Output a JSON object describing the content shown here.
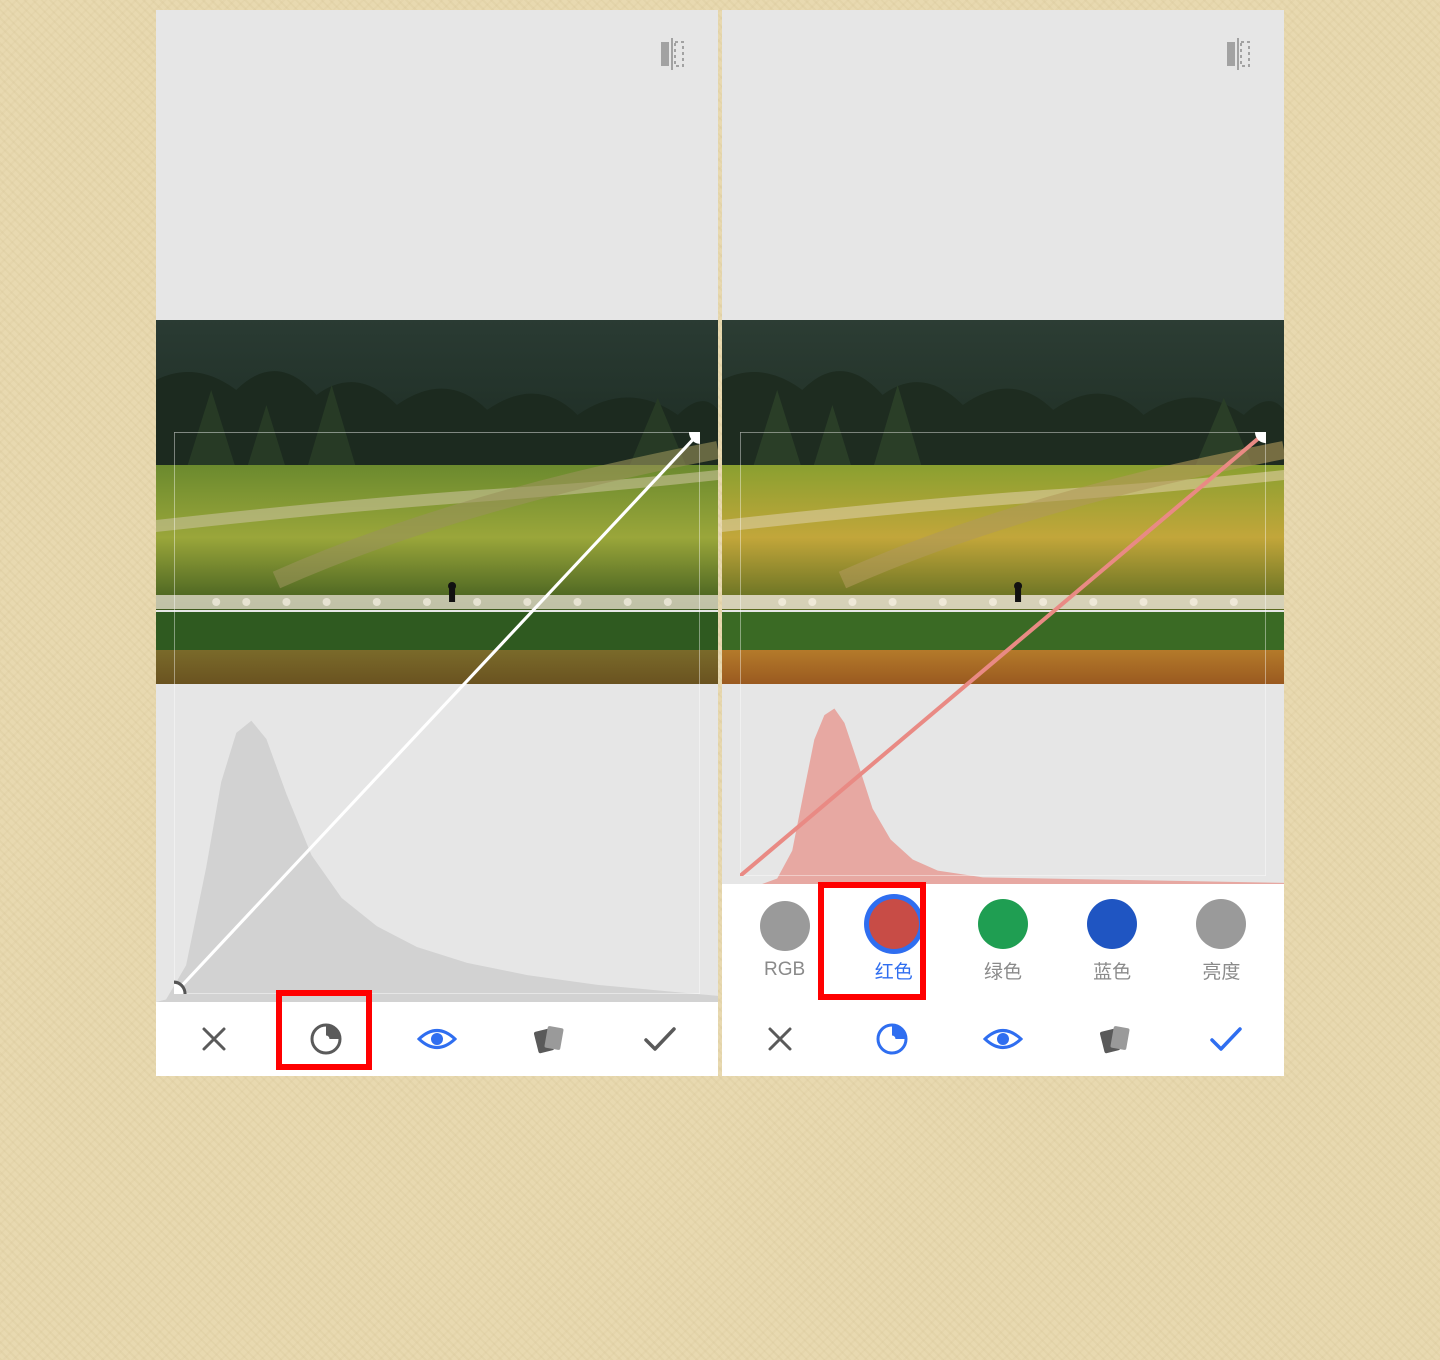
{
  "left": {
    "compare_icon": "compare-icon",
    "bottom": {
      "close": "close",
      "channel": "channel",
      "eye": "eye",
      "cards": "cards",
      "confirm": "confirm"
    },
    "curve_color": "#ffffff",
    "highlight_target": "channel-button"
  },
  "right": {
    "channels": [
      {
        "key": "rgb",
        "label": "RGB",
        "color": "#9a9a9a",
        "selected": false
      },
      {
        "key": "red",
        "label": "红色",
        "color": "#c84c46",
        "selected": true
      },
      {
        "key": "green",
        "label": "绿色",
        "color": "#1f9e52",
        "selected": false
      },
      {
        "key": "blue",
        "label": "蓝色",
        "color": "#1f55c2",
        "selected": false
      },
      {
        "key": "luma",
        "label": "亮度",
        "color": "#9a9a9a",
        "selected": false
      }
    ],
    "curve_color": "#e98a84",
    "bottom": {
      "close": "close",
      "channel": "channel",
      "eye": "eye",
      "cards": "cards",
      "confirm": "confirm"
    },
    "highlight_target": "channel-red"
  }
}
